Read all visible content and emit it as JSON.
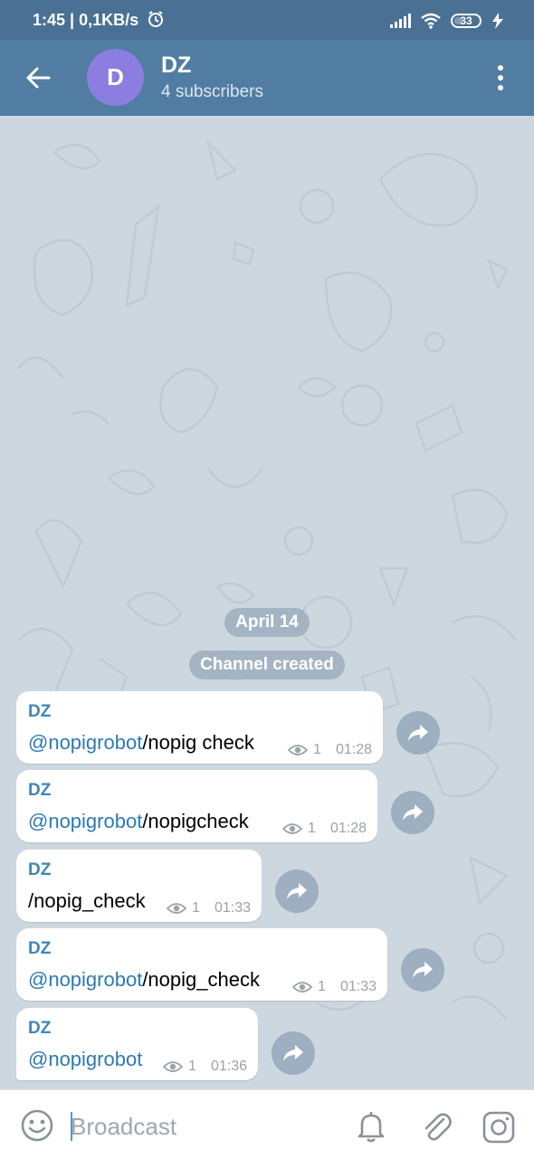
{
  "status_bar": {
    "left_text": "1:45 | 0,1KB/s",
    "battery_level": "33"
  },
  "header": {
    "avatar_letter": "D",
    "title": "DZ",
    "subtitle": "4 subscribers"
  },
  "chat": {
    "date_label": "April 14",
    "service_message": "Channel created",
    "messages": [
      {
        "author": "DZ",
        "mention": "@nopigrobot",
        "text": "/nopig check",
        "views": "1",
        "time": "01:28"
      },
      {
        "author": "DZ",
        "mention": "@nopigrobot",
        "text": "/nopigcheck",
        "views": "1",
        "time": "01:28"
      },
      {
        "author": "DZ",
        "mention": "",
        "text": "/nopig_check",
        "views": "1",
        "time": "01:33"
      },
      {
        "author": "DZ",
        "mention": "@nopigrobot",
        "text": "/nopig_check",
        "views": "1",
        "time": "01:33"
      },
      {
        "author": "DZ",
        "mention": "@nopigrobot",
        "text": "",
        "views": "1",
        "time": "01:36"
      }
    ]
  },
  "composer": {
    "placeholder": "Broadcast"
  },
  "colors": {
    "status_bar": "#4a7194",
    "app_bar": "#517da2",
    "avatar": "#8b7ee0",
    "link": "#2d7ab4",
    "author": "#3e86b8"
  },
  "icons": [
    "wifi-icon",
    "signal-icon",
    "alarm-icon",
    "charging-icon",
    "back-arrow-icon",
    "more-vert-icon",
    "share-icon",
    "eye-icon",
    "emoji-icon",
    "bell-icon",
    "paperclip-icon",
    "camera-icon"
  ]
}
